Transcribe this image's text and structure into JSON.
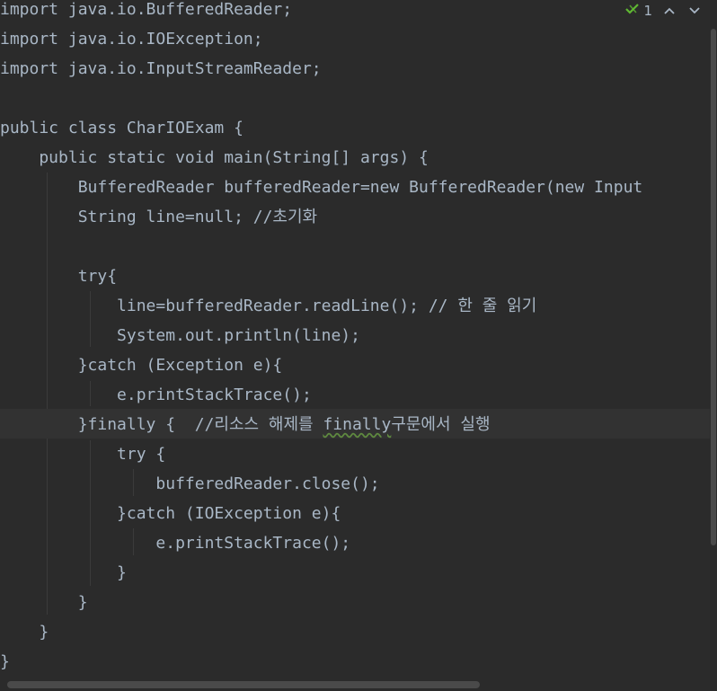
{
  "editor": {
    "lines": [
      "import java.io.BufferedReader;",
      "import java.io.IOException;",
      "import java.io.InputStreamReader;",
      "",
      "public class CharIOExam {",
      "    public static void main(String[] args) {",
      "        BufferedReader bufferedReader=new BufferedReader(new Input",
      "        String line=null; //초기화",
      "",
      "        try{",
      "            line=bufferedReader.readLine(); // 한 줄 읽기",
      "            System.out.println(line);",
      "        }catch (Exception e){",
      "            e.printStackTrace();",
      "        }finally {  //리소스 해제를 ",
      "            try {",
      "                bufferedReader.close();",
      "            }catch (IOException e){",
      "                e.printStackTrace();",
      "            }",
      "        }",
      "    }",
      "}"
    ],
    "finally_line_word": "finally",
    "finally_line_tail": "구문에서 실행"
  },
  "inspection": {
    "check_icon": "check-icon",
    "count": "1",
    "up_icon": "chevron-up-icon",
    "down_icon": "chevron-down-icon"
  },
  "colors": {
    "background": "#2b2b2b",
    "text": "#a9b7c6",
    "current_line": "#323232",
    "check": "#5fb832"
  }
}
